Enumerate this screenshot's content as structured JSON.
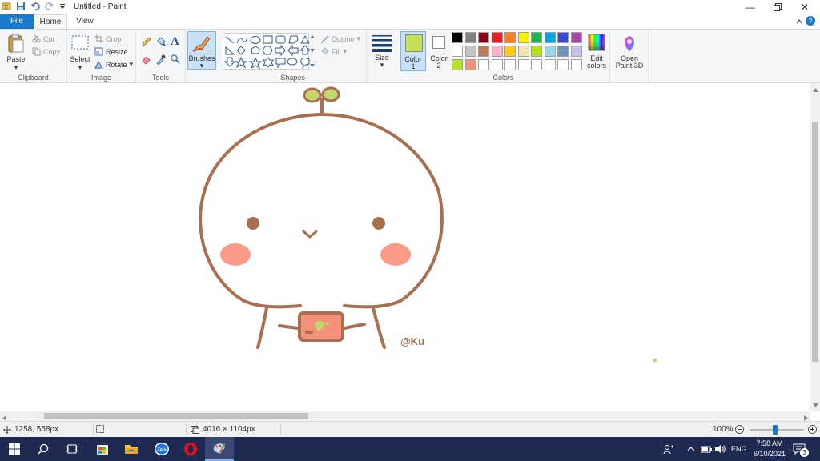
{
  "window": {
    "title": "Untitled - Paint"
  },
  "tabs": {
    "file": "File",
    "home": "Home",
    "view": "View"
  },
  "clipboard": {
    "paste": "Paste",
    "cut": "Cut",
    "copy": "Copy",
    "group": "Clipboard"
  },
  "image": {
    "select": "Select",
    "crop": "Crop",
    "resize": "Resize",
    "rotate": "Rotate",
    "group": "Image"
  },
  "tools": {
    "group": "Tools"
  },
  "brushes": {
    "label": "Brushes"
  },
  "shapes": {
    "outline": "Outline",
    "fill": "Fill",
    "group": "Shapes"
  },
  "size": {
    "label": "Size"
  },
  "colors": {
    "color1_label": "Color",
    "color1_num": "1",
    "color2_label": "Color",
    "color2_num": "2",
    "color1_value": "#c4e05a",
    "color2_value": "#ffffff",
    "group": "Colors",
    "edit_colors_1": "Edit",
    "edit_colors_2": "colors",
    "palette_row1": [
      "#000000",
      "#7f7f7f",
      "#880015",
      "#ed1c24",
      "#ff7f27",
      "#fff200",
      "#22b14c",
      "#00a2e8",
      "#3f48cc",
      "#a349a4"
    ],
    "palette_row2": [
      "#ffffff",
      "#c3c3c3",
      "#b97a57",
      "#ffaec9",
      "#ffc90e",
      "#efe4b0",
      "#b5e61d",
      "#99d9ea",
      "#7092be",
      "#c8bfe7"
    ],
    "palette_row3": [
      "#b5e61d",
      "#f4917a",
      "#ffffff",
      "#ffffff",
      "#ffffff",
      "#ffffff",
      "#ffffff",
      "#ffffff",
      "#ffffff",
      "#ffffff"
    ]
  },
  "paint3d": {
    "line1": "Open",
    "line2": "Paint 3D"
  },
  "drawing": {
    "signature": "@Ku",
    "line_color": "#a8704f",
    "cheek_color": "#f99b88",
    "sprout_color": "#c4d66c",
    "phone_color": "#f4917a"
  },
  "status": {
    "cursor": "1258, 558px",
    "dimensions": "4016 × 1104px",
    "zoom": "100%"
  },
  "taskbar": {
    "lang": "ENG",
    "time": "7:58 AM",
    "date": "6/10/2021",
    "notifications": "3"
  }
}
